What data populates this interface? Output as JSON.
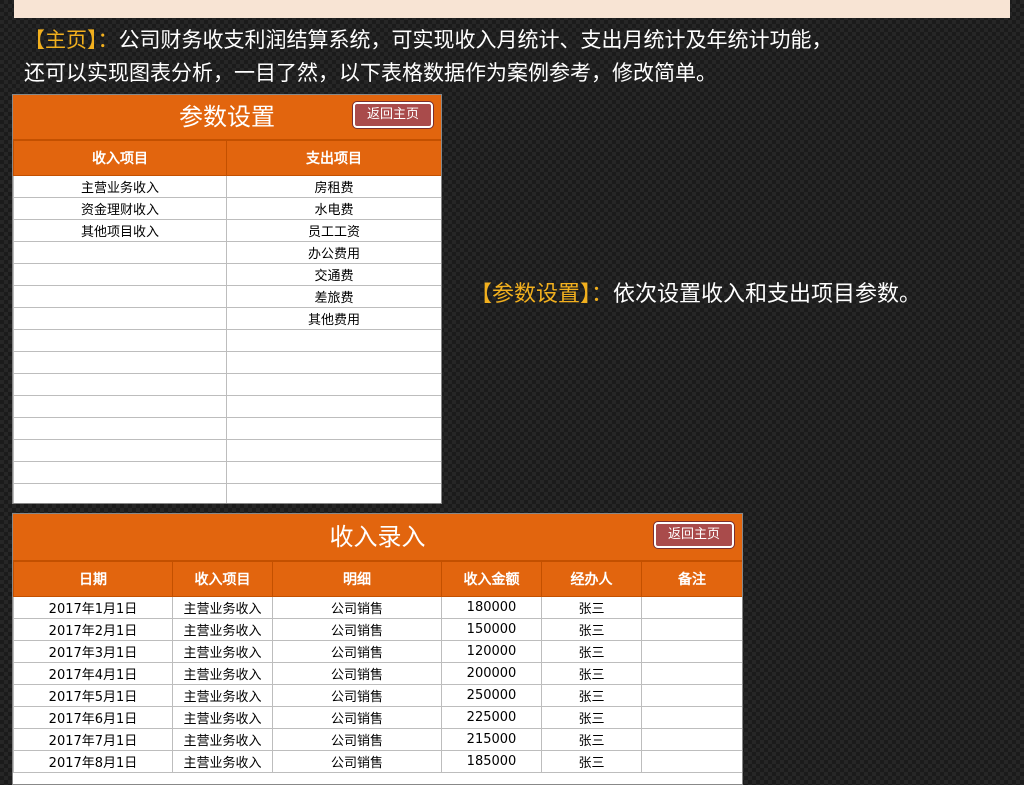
{
  "intro": {
    "tag": "【主页】：",
    "text_line1": "公司财务收支利润结算系统，可实现收入月统计、支出月统计及年统计功能，",
    "text_line2": "还可以实现图表分析，一目了然，以下表格数据作为案例参考，修改简单。"
  },
  "param_panel": {
    "title": "参数设置",
    "back_label": "返回主页",
    "col_income": "收入项目",
    "col_expense": "支出项目",
    "rows": [
      [
        "主营业务收入",
        "房租费"
      ],
      [
        "资金理财收入",
        "水电费"
      ],
      [
        "其他项目收入",
        "员工工资"
      ],
      [
        "",
        "办公费用"
      ],
      [
        "",
        "交通费"
      ],
      [
        "",
        "差旅费"
      ],
      [
        "",
        "其他费用"
      ],
      [
        "",
        ""
      ],
      [
        "",
        ""
      ],
      [
        "",
        ""
      ],
      [
        "",
        ""
      ],
      [
        "",
        ""
      ],
      [
        "",
        ""
      ],
      [
        "",
        ""
      ],
      [
        "",
        ""
      ]
    ]
  },
  "param_desc": {
    "tag": "【参数设置】：",
    "text": "依次设置收入和支出项目参数。"
  },
  "income_panel": {
    "title": "收入录入",
    "back_label": "返回主页",
    "headers": [
      "日期",
      "收入项目",
      "明细",
      "收入金额",
      "经办人",
      "备注"
    ],
    "rows": [
      [
        "2017年1月1日",
        "主营业务收入",
        "公司销售",
        "180000",
        "张三",
        ""
      ],
      [
        "2017年2月1日",
        "主营业务收入",
        "公司销售",
        "150000",
        "张三",
        ""
      ],
      [
        "2017年3月1日",
        "主营业务收入",
        "公司销售",
        "120000",
        "张三",
        ""
      ],
      [
        "2017年4月1日",
        "主营业务收入",
        "公司销售",
        "200000",
        "张三",
        ""
      ],
      [
        "2017年5月1日",
        "主营业务收入",
        "公司销售",
        "250000",
        "张三",
        ""
      ],
      [
        "2017年6月1日",
        "主营业务收入",
        "公司销售",
        "225000",
        "张三",
        ""
      ],
      [
        "2017年7月1日",
        "主营业务收入",
        "公司销售",
        "215000",
        "张三",
        ""
      ],
      [
        "2017年8月1日",
        "主营业务收入",
        "公司销售",
        "185000",
        "张三",
        ""
      ]
    ]
  }
}
